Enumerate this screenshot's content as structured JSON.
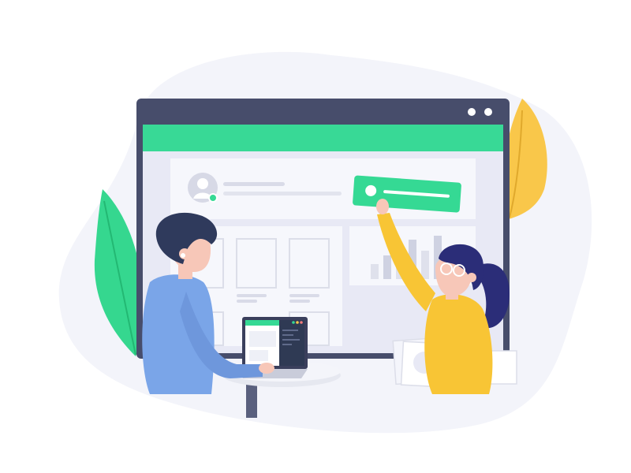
{
  "colors": {
    "background": "#ffffff",
    "blob": "#f3f4fa",
    "window_frame": "#474d6b",
    "window_header": "#38d996",
    "window_content": "#e8e9f5",
    "card": "#f6f7fc",
    "card_line": "#d9dbe8",
    "accent_green": "#35d994",
    "leaf_green": "#35d78f",
    "leaf_yellow": "#f9c74a",
    "man_shirt": "#7aa5e8",
    "man_hair": "#2f3a5c",
    "woman_sweater": "#f8c535",
    "woman_hair": "#2b2d78",
    "skin": "#f7c7b8",
    "laptop_screen": "#2f3a54",
    "table_top": "#e6e8f0",
    "table_leg": "#5a607e"
  },
  "illustration": {
    "subject": "two-people-building-dashboard",
    "window_controls": 2,
    "chart_bar_levels": [
      0.35,
      0.55,
      0.75,
      0.9,
      0.65,
      1.0
    ]
  }
}
